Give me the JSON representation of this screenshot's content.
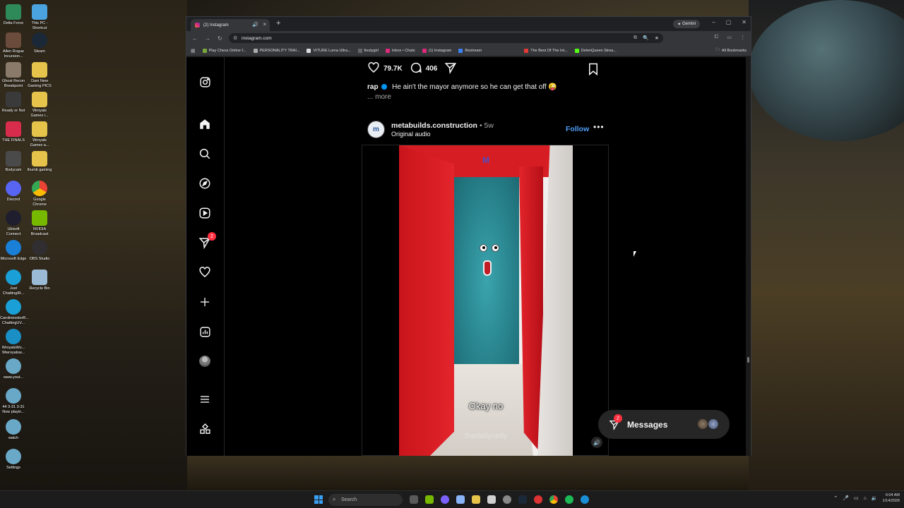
{
  "desktop": {
    "icons_col1": [
      "Delta Force",
      "Allen Rogue Incursion...",
      "Ghost Recon Breakpoint",
      "Ready or Not",
      "THE FINALS",
      "Bodycam",
      "Discord",
      "Ubisoft Connect",
      "Microsoft Edge",
      "Just ChattingIR...",
      "CarolinevstorR... ChattingUV...",
      "WroyalsWo... Wwroyalsw...",
      "www.yout...",
      "44 3-31 3-31 Now playin...",
      "watch",
      "Settings"
    ],
    "icons_col2": [
      "This PC - Shortcut",
      "Steam",
      "Dani New Gaming PICS",
      "Wroyals Games i...",
      "Wroyals Games a...",
      "thumb gaming",
      "Google Chrome",
      "NVIDIA Broadcast",
      "OBS Studio",
      "Recycle Bin"
    ]
  },
  "browser": {
    "tab_title": "(2) Instagram",
    "gemini_label": "Gemini",
    "url": "instagram.com",
    "bookmarks": [
      "Play Chess Online f...",
      "PERSONALITY TRAI...",
      "VITURE Luma Ultra...",
      "fiestygirl",
      "Inbox • Chats",
      "(1) Instagram",
      "Restream",
      "The Best Of The Int...",
      "DelenQueen Strea..."
    ],
    "all_bookmarks": "All Bookmarks"
  },
  "instagram": {
    "nav_badge": "2",
    "likes": "79.7K",
    "comments": "406",
    "caption_user": "rap",
    "caption_text": "He ain't the mayor anymore so he can get that off",
    "more": "... more",
    "post": {
      "username": "metabuilds.construction",
      "time": "• 5w",
      "audio": "Original audio",
      "follow": "Follow",
      "subtitle": "Okay no",
      "watermark": "thedailynelly"
    },
    "messages": {
      "label": "Messages",
      "badge": "2"
    }
  },
  "taskbar": {
    "search_placeholder": "Search",
    "time": "6:04 AM",
    "date": "1/14/2026"
  }
}
